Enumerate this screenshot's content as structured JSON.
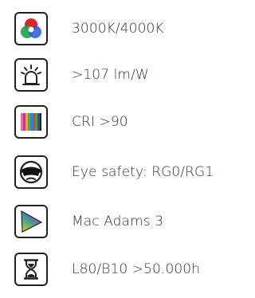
{
  "specs": [
    {
      "icon": "rgb-color-circles-icon",
      "label": "3000K/4000K"
    },
    {
      "icon": "light-bulb-icon",
      "label": ">107 lm/W"
    },
    {
      "icon": "color-bars-icon",
      "label": "CRI >90"
    },
    {
      "icon": "safety-goggles-face-icon",
      "label": "Eye safety: RG0/RG1"
    },
    {
      "icon": "color-gamut-triangle-icon",
      "label": "Mac Adams 3"
    },
    {
      "icon": "hourglass-icon",
      "label": "L80/B10 >50.000h"
    }
  ],
  "colors": {
    "text": "#333333",
    "icon_outline": "#222222"
  }
}
